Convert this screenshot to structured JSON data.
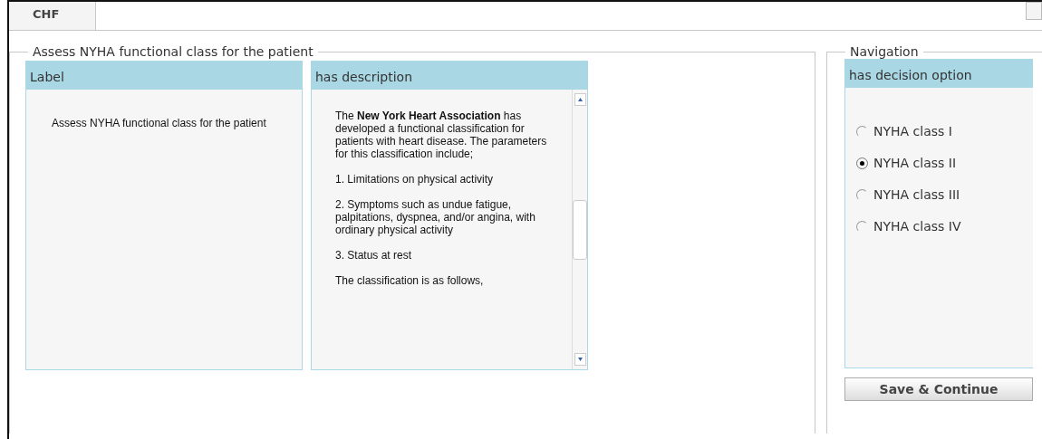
{
  "tabs": [
    {
      "label": "CHF",
      "selected": true
    }
  ],
  "assessment": {
    "legend": "Assess NYHA functional class for the patient",
    "label_panel": {
      "header": "Label",
      "text": "Assess NYHA functional class for the patient"
    },
    "description_panel": {
      "header": "has description",
      "paragraphs": [
        "The **New York Heart Association** has developed a functional classification for patients with heart disease. The parameters for this classification include;",
        "1. Limitations on physical activity",
        "2. Symptoms such as undue fatigue, palpitations, dyspnea, and/or angina, with ordinary physical activity",
        "3. Status at rest",
        "The classification is as follows,"
      ]
    }
  },
  "navigation": {
    "legend": "Navigation",
    "header": "has decision option",
    "options": [
      {
        "label": "NYHA class I",
        "selected": false
      },
      {
        "label": "NYHA class II",
        "selected": true
      },
      {
        "label": "NYHA class III",
        "selected": false
      },
      {
        "label": "NYHA class IV",
        "selected": false
      }
    ],
    "button": "Save & Continue"
  }
}
